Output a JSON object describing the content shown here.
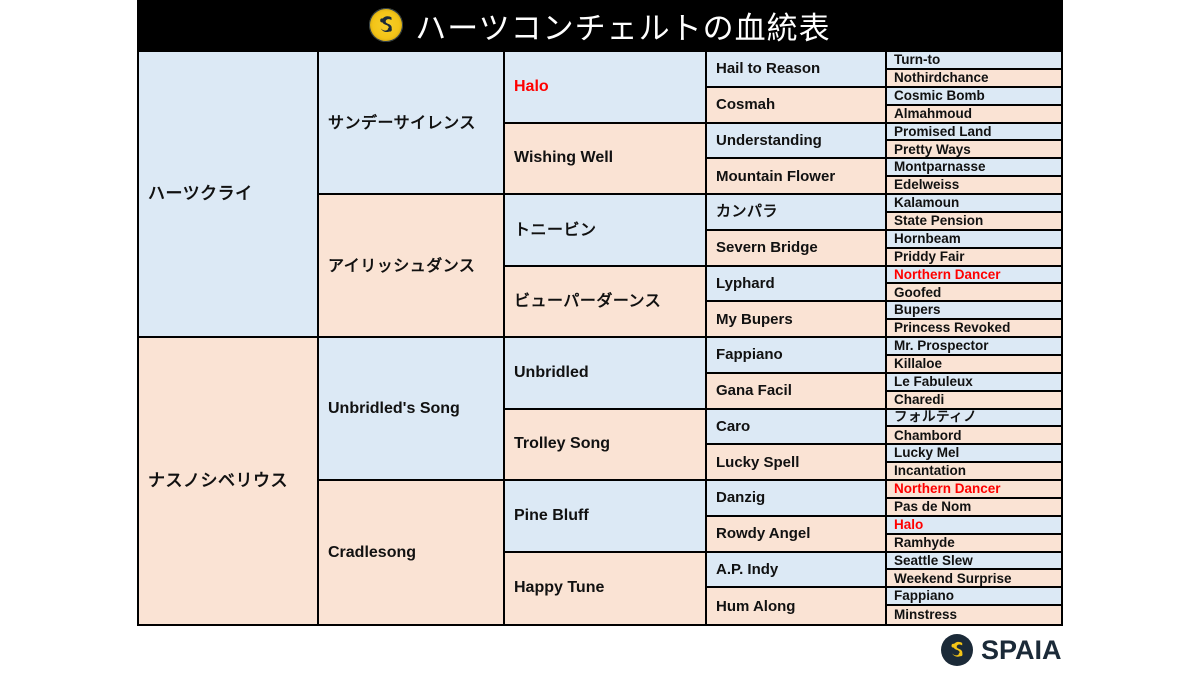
{
  "header": {
    "title": "ハーツコンチェルトの血統表",
    "logo_icon": "spaia-swirl-icon",
    "background_color": "#000000",
    "text_color": "#ffffff"
  },
  "colors": {
    "sire_blue": "#dce9f5",
    "dam_pink": "#fae3d4",
    "border": "#000000",
    "inbred_red": "#ff0000",
    "brand_dark": "#1b2a38",
    "brand_gold": "#f3c417"
  },
  "footer": {
    "brand_name": "SPAIA",
    "logo_icon": "spaia-swirl-icon"
  },
  "pedigree": {
    "generation1": [
      {
        "name": "ハーツクライ",
        "tone": "blue",
        "lang": "jp",
        "highlight": false,
        "span": 8
      },
      {
        "name": "ナスノシベリウス",
        "tone": "pink",
        "lang": "jp",
        "highlight": false,
        "span": 8
      }
    ],
    "generation2": [
      {
        "name": "サンデーサイレンス",
        "tone": "blue",
        "lang": "jp",
        "highlight": false,
        "span": 4
      },
      {
        "name": "アイリッシュダンス",
        "tone": "pink",
        "lang": "jp",
        "highlight": false,
        "span": 4
      },
      {
        "name": "Unbridled's Song",
        "tone": "blue",
        "lang": "en",
        "highlight": false,
        "span": 4
      },
      {
        "name": "Cradlesong",
        "tone": "pink",
        "lang": "en",
        "highlight": false,
        "span": 4
      }
    ],
    "generation3": [
      {
        "name": "Halo",
        "tone": "blue",
        "lang": "en",
        "highlight": true,
        "span": 2
      },
      {
        "name": "Wishing Well",
        "tone": "pink",
        "lang": "en",
        "highlight": false,
        "span": 2
      },
      {
        "name": "トニービン",
        "tone": "blue",
        "lang": "jp",
        "highlight": false,
        "span": 2
      },
      {
        "name": "ビューパーダーンス",
        "tone": "pink",
        "lang": "jp",
        "highlight": false,
        "span": 2
      },
      {
        "name": "Unbridled",
        "tone": "blue",
        "lang": "en",
        "highlight": false,
        "span": 2
      },
      {
        "name": "Trolley Song",
        "tone": "pink",
        "lang": "en",
        "highlight": false,
        "span": 2
      },
      {
        "name": "Pine Bluff",
        "tone": "blue",
        "lang": "en",
        "highlight": false,
        "span": 2
      },
      {
        "name": "Happy Tune",
        "tone": "pink",
        "lang": "en",
        "highlight": false,
        "span": 2
      }
    ],
    "generation4": [
      {
        "name": "Hail to Reason",
        "tone": "blue",
        "lang": "en",
        "highlight": false
      },
      {
        "name": "Cosmah",
        "tone": "pink",
        "lang": "en",
        "highlight": false
      },
      {
        "name": "Understanding",
        "tone": "blue",
        "lang": "en",
        "highlight": false
      },
      {
        "name": "Mountain Flower",
        "tone": "pink",
        "lang": "en",
        "highlight": false
      },
      {
        "name": "カンパラ",
        "tone": "blue",
        "lang": "jp",
        "highlight": false
      },
      {
        "name": "Severn Bridge",
        "tone": "pink",
        "lang": "en",
        "highlight": false
      },
      {
        "name": "Lyphard",
        "tone": "blue",
        "lang": "en",
        "highlight": false
      },
      {
        "name": "My Bupers",
        "tone": "pink",
        "lang": "en",
        "highlight": false
      },
      {
        "name": "Fappiano",
        "tone": "blue",
        "lang": "en",
        "highlight": false
      },
      {
        "name": "Gana Facil",
        "tone": "pink",
        "lang": "en",
        "highlight": false
      },
      {
        "name": "Caro",
        "tone": "blue",
        "lang": "en",
        "highlight": false
      },
      {
        "name": "Lucky Spell",
        "tone": "pink",
        "lang": "en",
        "highlight": false
      },
      {
        "name": "Danzig",
        "tone": "blue",
        "lang": "en",
        "highlight": false
      },
      {
        "name": "Rowdy Angel",
        "tone": "pink",
        "lang": "en",
        "highlight": false
      },
      {
        "name": "A.P. Indy",
        "tone": "blue",
        "lang": "en",
        "highlight": false
      },
      {
        "name": "Hum Along",
        "tone": "pink",
        "lang": "en",
        "highlight": false
      }
    ],
    "generation5": [
      {
        "name": "Turn-to",
        "tone": "blue",
        "lang": "en",
        "highlight": false
      },
      {
        "name": "Nothirdchance",
        "tone": "pink",
        "lang": "en",
        "highlight": false
      },
      {
        "name": "Cosmic Bomb",
        "tone": "blue",
        "lang": "en",
        "highlight": false
      },
      {
        "name": "Almahmoud",
        "tone": "pink",
        "lang": "en",
        "highlight": false
      },
      {
        "name": "Promised Land",
        "tone": "blue",
        "lang": "en",
        "highlight": false
      },
      {
        "name": "Pretty Ways",
        "tone": "pink",
        "lang": "en",
        "highlight": false
      },
      {
        "name": "Montparnasse",
        "tone": "blue",
        "lang": "en",
        "highlight": false
      },
      {
        "name": "Edelweiss",
        "tone": "pink",
        "lang": "en",
        "highlight": false
      },
      {
        "name": "Kalamoun",
        "tone": "blue",
        "lang": "en",
        "highlight": false
      },
      {
        "name": "State Pension",
        "tone": "pink",
        "lang": "en",
        "highlight": false
      },
      {
        "name": "Hornbeam",
        "tone": "blue",
        "lang": "en",
        "highlight": false
      },
      {
        "name": "Priddy Fair",
        "tone": "pink",
        "lang": "en",
        "highlight": false
      },
      {
        "name": "Northern Dancer",
        "tone": "blue",
        "lang": "en",
        "highlight": true
      },
      {
        "name": "Goofed",
        "tone": "pink",
        "lang": "en",
        "highlight": false
      },
      {
        "name": "Bupers",
        "tone": "blue",
        "lang": "en",
        "highlight": false
      },
      {
        "name": "Princess Revoked",
        "tone": "pink",
        "lang": "en",
        "highlight": false
      },
      {
        "name": "Mr. Prospector",
        "tone": "blue",
        "lang": "en",
        "highlight": false
      },
      {
        "name": "Killaloe",
        "tone": "pink",
        "lang": "en",
        "highlight": false
      },
      {
        "name": "Le Fabuleux",
        "tone": "blue",
        "lang": "en",
        "highlight": false
      },
      {
        "name": "Charedi",
        "tone": "pink",
        "lang": "en",
        "highlight": false
      },
      {
        "name": "フォルティノ",
        "tone": "blue",
        "lang": "jp",
        "highlight": false
      },
      {
        "name": "Chambord",
        "tone": "pink",
        "lang": "en",
        "highlight": false
      },
      {
        "name": "Lucky Mel",
        "tone": "blue",
        "lang": "en",
        "highlight": false
      },
      {
        "name": "Incantation",
        "tone": "pink",
        "lang": "en",
        "highlight": false
      },
      {
        "name": "Northern Dancer",
        "tone": "pink",
        "lang": "en",
        "highlight": true
      },
      {
        "name": "Pas de Nom",
        "tone": "pink",
        "lang": "en",
        "highlight": false
      },
      {
        "name": "Halo",
        "tone": "blue",
        "lang": "en",
        "highlight": true
      },
      {
        "name": "Ramhyde",
        "tone": "pink",
        "lang": "en",
        "highlight": false
      },
      {
        "name": "Seattle Slew",
        "tone": "blue",
        "lang": "en",
        "highlight": false
      },
      {
        "name": "Weekend Surprise",
        "tone": "pink",
        "lang": "en",
        "highlight": false
      },
      {
        "name": "Fappiano",
        "tone": "blue",
        "lang": "en",
        "highlight": false
      },
      {
        "name": "Minstress",
        "tone": "pink",
        "lang": "en",
        "highlight": false
      }
    ]
  }
}
